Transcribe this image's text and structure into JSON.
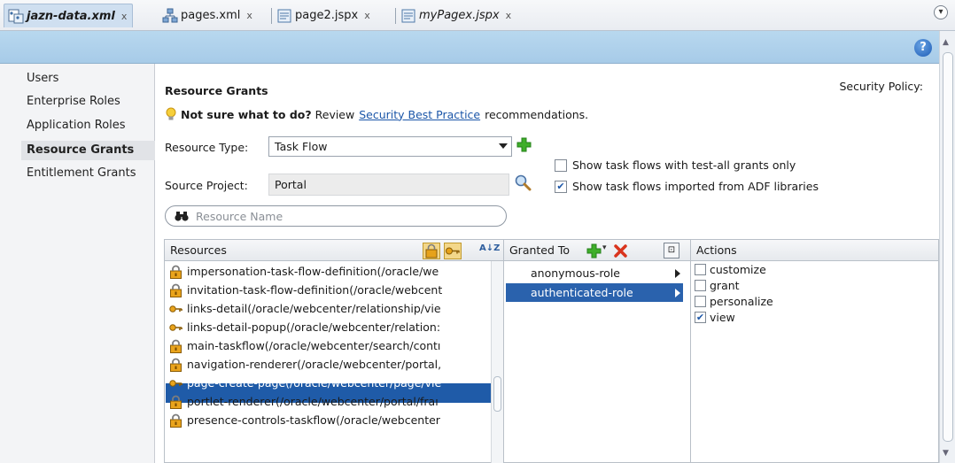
{
  "tabs": [
    {
      "label": "jazn-data.xml",
      "active": true
    },
    {
      "label": "pages.xml"
    },
    {
      "label": "page2.jspx"
    },
    {
      "label": "myPagex.jspx"
    }
  ],
  "tab_close": "x",
  "help_label": "?",
  "nav": {
    "items": [
      "Users",
      "Enterprise Roles",
      "Application Roles",
      "Resource Grants",
      "Entitlement Grants"
    ],
    "selected": "Resource Grants"
  },
  "main": {
    "title": "Resource Grants",
    "security_policy_label": "Security Policy:",
    "tip_bold": "Not sure what to do?",
    "tip_pre": "Review",
    "tip_link": "Security Best Practice",
    "tip_post": "recommendations.",
    "resource_type_label": "Resource Type:",
    "resource_type_value": "Task Flow",
    "source_project_label": "Source Project:",
    "source_project_value": "Portal",
    "check_test_all": "Show task flows with test-all grants only",
    "check_test_all_checked": false,
    "check_imported": "Show task flows imported from ADF libraries",
    "check_imported_checked": true,
    "search_placeholder": "Resource Name"
  },
  "resources": {
    "header": "Resources",
    "rows": [
      {
        "text": "impersonation-task-flow-definition(/oracle/we",
        "icon": "lock-icon"
      },
      {
        "text": "invitation-task-flow-definition(/oracle/webcent",
        "icon": "lock-icon"
      },
      {
        "text": "links-detail(/oracle/webcenter/relationship/vie",
        "icon": "key-icon"
      },
      {
        "text": "links-detail-popup(/oracle/webcenter/relation:",
        "icon": "key-icon"
      },
      {
        "text": "main-taskflow(/oracle/webcenter/search/contı",
        "icon": "lock-icon"
      },
      {
        "text": "navigation-renderer(/oracle/webcenter/portal,",
        "icon": "lock-icon"
      },
      {
        "text": "page-create-page(/oracle/webcenter/page/vie",
        "icon": "key-icon",
        "selected": true
      },
      {
        "text": "portlet-renderer(/oracle/webcenter/portal/fraı",
        "icon": "lock-icon"
      },
      {
        "text": "presence-controls-taskflow(/oracle/webcenter",
        "icon": "lock-icon"
      }
    ]
  },
  "granted_to": {
    "header": "Granted To",
    "rows": [
      {
        "text": "anonymous-role"
      },
      {
        "text": "authenticated-role",
        "selected": true
      }
    ]
  },
  "actions": {
    "header": "Actions",
    "rows": [
      {
        "text": "customize",
        "checked": false
      },
      {
        "text": "grant",
        "checked": false
      },
      {
        "text": "personalize",
        "checked": false
      },
      {
        "text": "view",
        "checked": true
      }
    ]
  },
  "colors": {
    "selection": "#1f5ba8",
    "band": "#a7cbe8",
    "link": "#1b56a8",
    "add_green": "#3fae2a",
    "delete_red": "#d9341d"
  }
}
